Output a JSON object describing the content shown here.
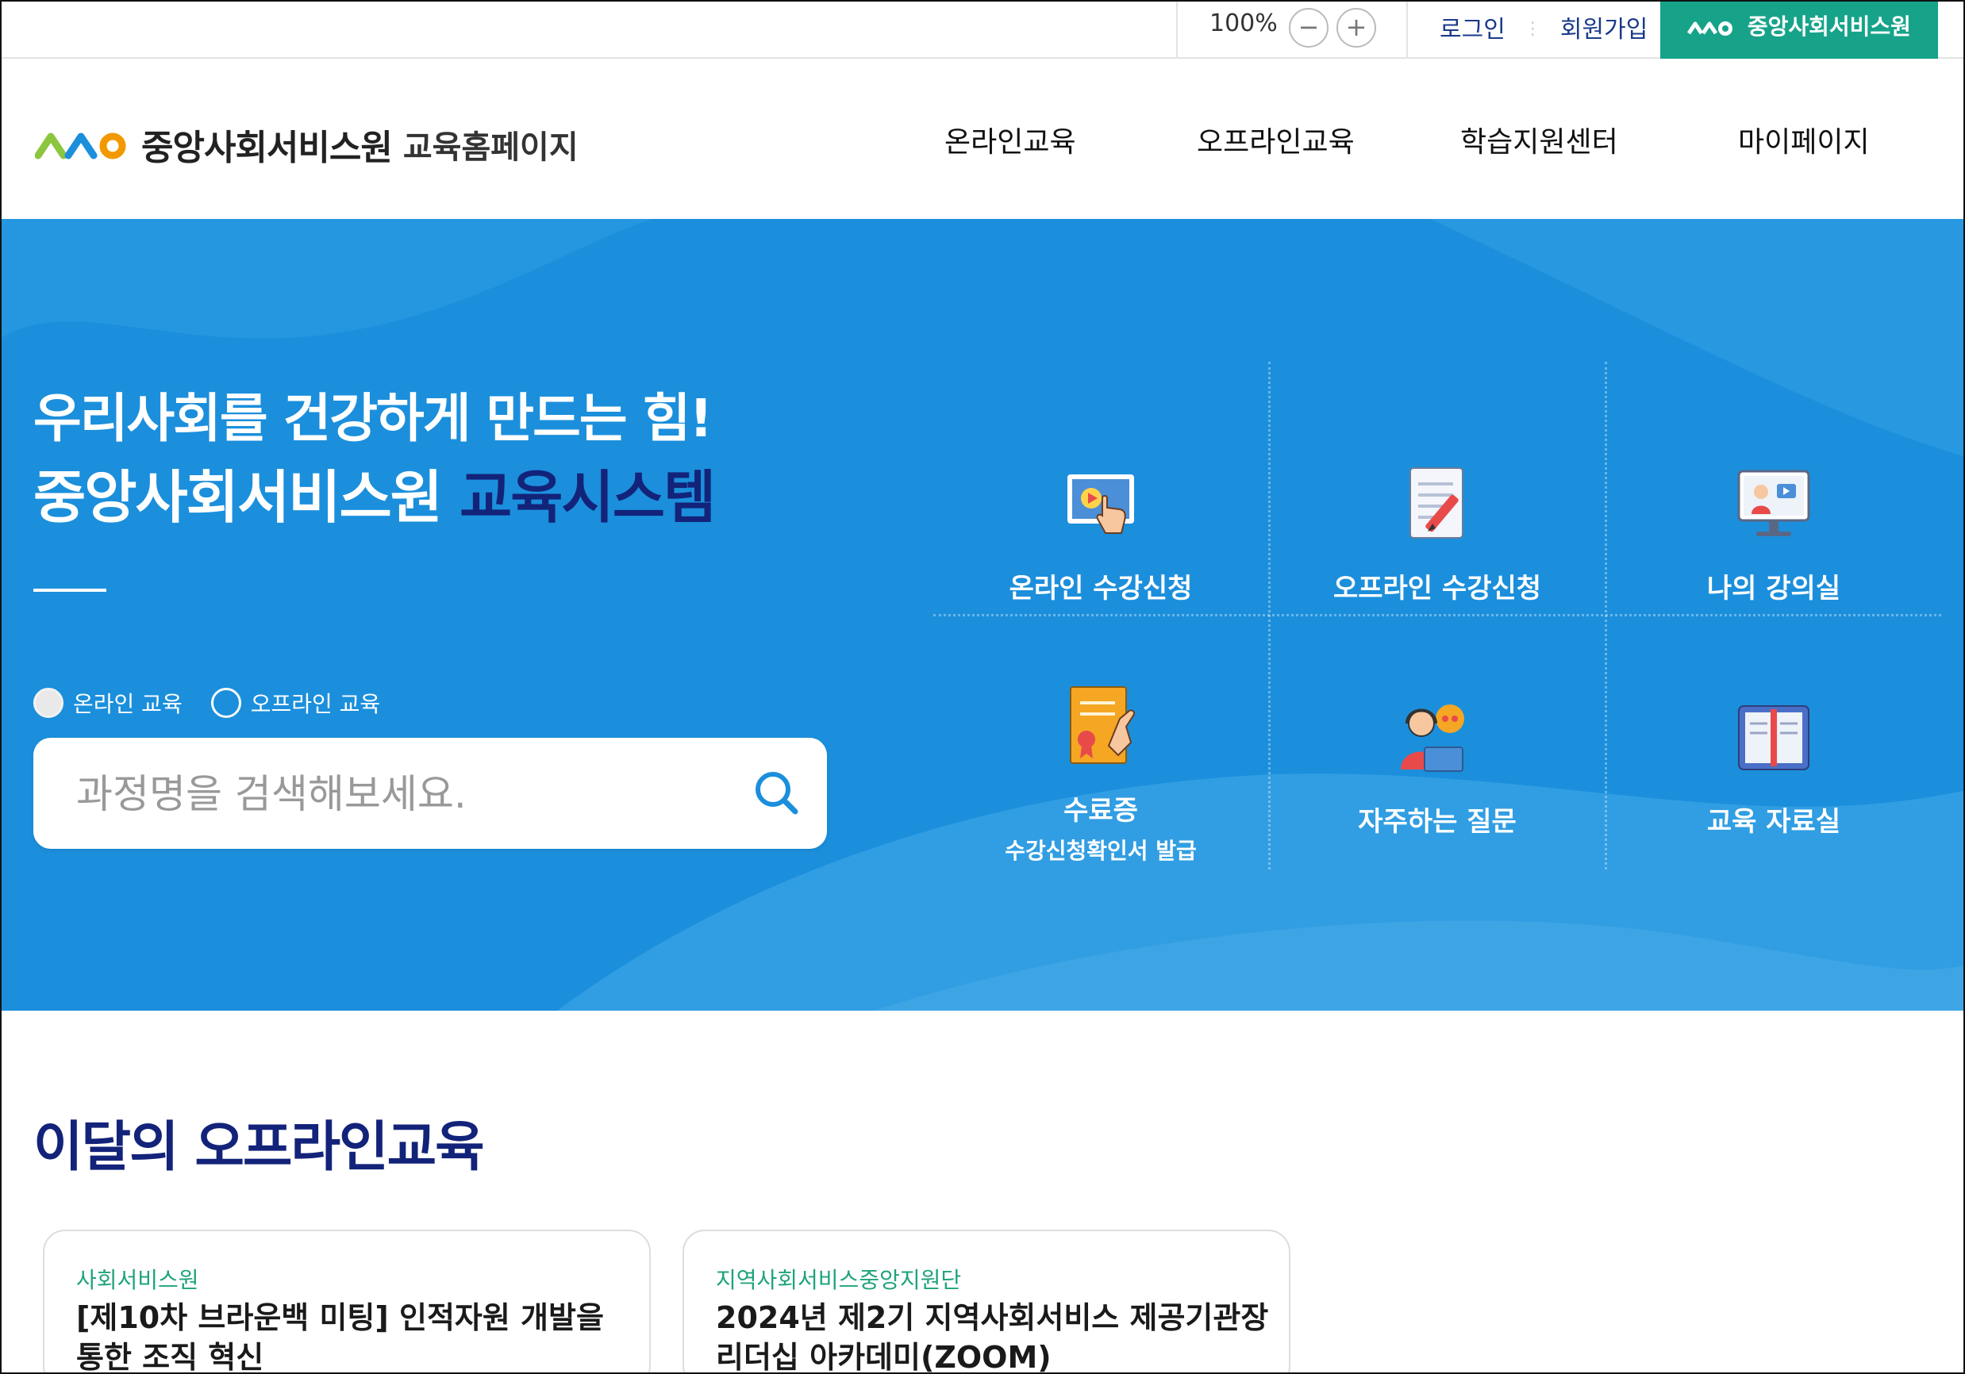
{
  "utility_bar": {
    "zoom_level": "100%",
    "zoom_out_symbol": "−",
    "zoom_in_symbol": "+",
    "login_label": "로그인",
    "signup_label": "회원가입",
    "brand_button_label": "중앙사회서비스원"
  },
  "header": {
    "logo_name": "중앙사회서비스원",
    "logo_sub": "교육홈페이지",
    "nav": [
      "온라인교육",
      "오프라인교육",
      "학습지원센터",
      "마이페이지"
    ]
  },
  "hero": {
    "line1": "우리사회를 건강하게 만드는 힘!",
    "line2_prefix": "중앙사회서비스원",
    "line2_highlight": "교육시스템",
    "radio_options": [
      {
        "label": "온라인 교육",
        "selected": true
      },
      {
        "label": "오프라인 교육",
        "selected": false
      }
    ],
    "search_placeholder": "과정명을 검색해보세요.",
    "tiles": [
      {
        "label": "온라인 수강신청",
        "sub": "",
        "icon": "video-click-icon"
      },
      {
        "label": "오프라인 수강신청",
        "sub": "",
        "icon": "document-pen-icon"
      },
      {
        "label": "나의 강의실",
        "sub": "",
        "icon": "monitor-lecture-icon"
      },
      {
        "label": "수료증",
        "sub": "수강신청확인서 발급",
        "icon": "certificate-icon"
      },
      {
        "label": "자주하는 질문",
        "sub": "",
        "icon": "headset-support-icon"
      },
      {
        "label": "교육 자료실",
        "sub": "",
        "icon": "open-book-icon"
      }
    ]
  },
  "monthly": {
    "title": "이달의 오프라인교육",
    "cards": [
      {
        "category": "사회서비스원",
        "title": "[제10차 브라운백 미팅] 인적자원 개발을 통한 조직 혁신"
      },
      {
        "category": "지역사회서비스중앙지원단",
        "title": "2024년 제2기 지역사회서비스 제공기관장 리더십 아카데미(ZOOM)"
      }
    ]
  },
  "colors": {
    "hero_blue": "#1b8fdc",
    "navy": "#13237a",
    "brand_green": "#16a38a",
    "category_green": "#1fa37c"
  }
}
